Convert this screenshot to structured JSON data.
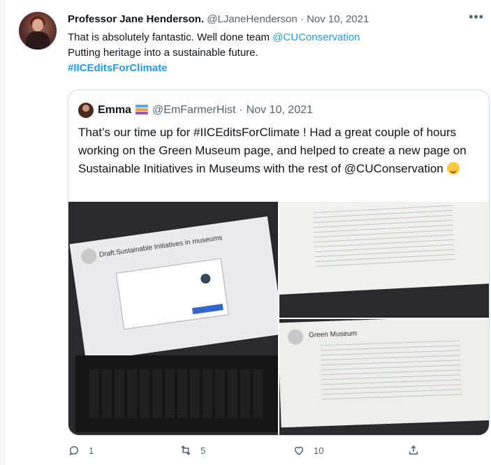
{
  "tweet": {
    "author_name": "Professor Jane Henderson.",
    "handle": "@LJaneHenderson",
    "separator": "·",
    "date": "Nov 10, 2021",
    "more_icon": "more-horizontal-icon",
    "line1_text": "That is absolutely fantastic. Well done team ",
    "line1_mention": "@CUConservation",
    "line2_text": "Putting heritage into a sustainable future.",
    "hashtag": "#IICEditsForClimate"
  },
  "quote": {
    "author_name": "Emma",
    "handle": "@EmFarmerHist",
    "separator": "·",
    "date": "Nov 10, 2021",
    "body": "That’s our time up for  #IICEditsForClimate ! Had a great couple of hours working on the Green Museum page, and helped to create a new page on Sustainable Initiatives in Museums with the rest of @CUConservation"
  },
  "photos": {
    "photo1_caption": "Draft:Sustainable Initiatives in museums",
    "photo3_caption": "Green Museum"
  },
  "actions": {
    "reply_count": "1",
    "retweet_count": "5",
    "like_count": "10",
    "share_icon": "share-icon"
  },
  "colors": {
    "accent": "#1d9bf0",
    "text": "#0f1419",
    "muted": "#536471",
    "border": "#cfd9de"
  }
}
